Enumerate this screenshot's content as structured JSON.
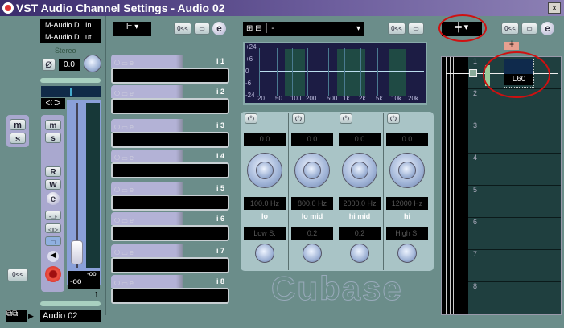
{
  "window": {
    "title": "VST Audio Channel Settings - Audio 02",
    "close": "x"
  },
  "channel": {
    "input": "M-Audio D...In",
    "output": "M-Audio D...ut",
    "stereo_label": "Stereo",
    "pan_value": "0.0",
    "pan_display": "<C>",
    "buttons": {
      "mute": "m",
      "solo": "s",
      "read": "R",
      "write": "W",
      "edit": "e"
    },
    "fader_value": "-oo",
    "peak_value": "-oo",
    "number": "1",
    "name": "Audio 02",
    "fader_level": 0.25
  },
  "left": {
    "mute": "m",
    "solo": "s",
    "reset": "0<<"
  },
  "toolbar": {
    "reset": "0<<",
    "bypass": "▭",
    "edit": "e"
  },
  "inserts": [
    "i 1",
    "i 2",
    "i 3",
    "i 4",
    "i 5",
    "i 6",
    "i 7",
    "i 8"
  ],
  "eq": {
    "preset": "-",
    "yticks": [
      "+24",
      "+6",
      "0",
      "-6",
      "-24"
    ],
    "xticks": [
      "20",
      "50",
      "100",
      "200",
      "500",
      "1k",
      "2k",
      "5k",
      "10k",
      "20k"
    ],
    "bands": [
      {
        "gain": "0.0",
        "freq": "100.0 Hz",
        "name": "lo",
        "q": "Low S."
      },
      {
        "gain": "0.0",
        "freq": "800.0 Hz",
        "name": "lo mid",
        "q": "0.2"
      },
      {
        "gain": "0.0",
        "freq": "2000.0 Hz",
        "name": "hi mid",
        "q": "0.2"
      },
      {
        "gain": "0.0",
        "freq": "12000 Hz",
        "name": "hi",
        "q": "High S."
      }
    ]
  },
  "sends": {
    "rows": [
      "1",
      "2",
      "3",
      "4",
      "5",
      "6",
      "7",
      "8"
    ],
    "send1_value": "L60"
  },
  "logo": "Cubase"
}
